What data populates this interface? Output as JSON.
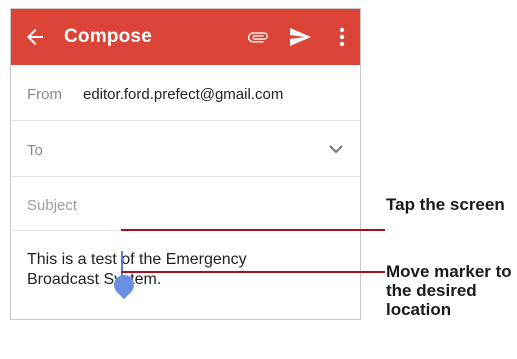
{
  "appbar": {
    "title": "Compose",
    "icons": [
      "back-arrow-icon",
      "attach-icon",
      "send-icon",
      "more-vertical-icon"
    ],
    "color": "#db4437"
  },
  "fields": {
    "from_label": "From",
    "from_value": "editor.ford.prefect@gmail.com",
    "to_label": "To",
    "subject_placeholder": "Subject"
  },
  "body": {
    "line1": "This is a test of the Emergency",
    "line2": "Broadcast System."
  },
  "callouts": [
    {
      "text": "Tap the screen"
    },
    {
      "text": "Move marker to the desired location"
    }
  ]
}
